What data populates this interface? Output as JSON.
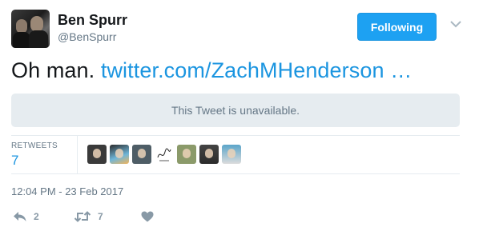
{
  "author": {
    "name": "Ben Spurr",
    "handle": "@BenSpurr",
    "avatar_icon": "profile-photo"
  },
  "follow_button": {
    "label": "Following"
  },
  "tweet": {
    "text": "Oh man. ",
    "link_text": "twitter.com/ZachMHenderson …"
  },
  "quoted_tweet": {
    "message": "This Tweet is unavailable."
  },
  "stats": {
    "retweets_label": "RETWEETS",
    "retweets_count": "7",
    "retweeter_avatars": [
      "avatar-1",
      "avatar-2",
      "avatar-3",
      "avatar-4",
      "avatar-5",
      "avatar-6",
      "avatar-7"
    ]
  },
  "timestamp": "12:04 PM - 23 Feb 2017",
  "actions": {
    "reply_icon": "reply-icon",
    "reply_count": "2",
    "retweet_icon": "retweet-icon",
    "retweet_count": "7",
    "like_icon": "heart-icon"
  },
  "colors": {
    "accent": "#1da1f2",
    "link": "#1b95e0",
    "muted": "#657786",
    "icon": "#8899a6",
    "panel": "#e6ecf0"
  }
}
